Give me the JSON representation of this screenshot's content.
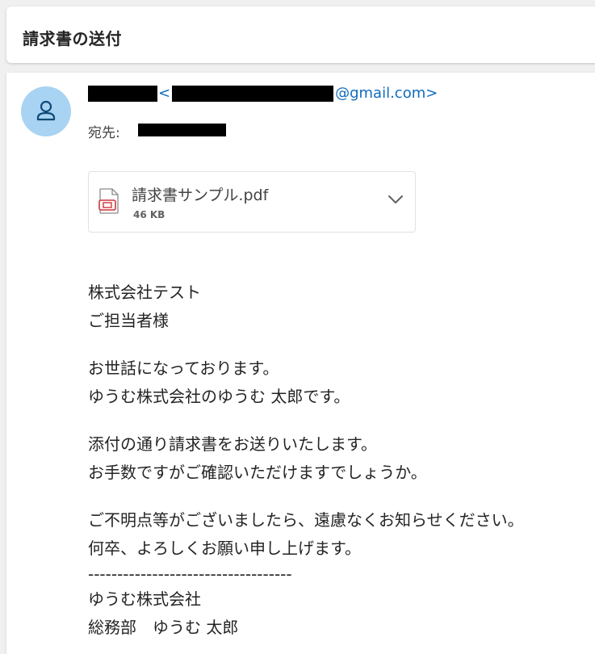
{
  "subject": "請求書の送付",
  "sender": {
    "email_prefix": "<",
    "email_domain": "@gmail.com>"
  },
  "recipient": {
    "label": "宛先:"
  },
  "attachment": {
    "icon": "pdf-file-icon",
    "name": "請求書サンプル.pdf",
    "size": "46 KB"
  },
  "body": {
    "greeting": [
      "株式会社テスト",
      "ご担当者様"
    ],
    "intro": [
      "お世話になっております。",
      "ゆうむ株式会社のゆうむ 太郎です。"
    ],
    "main": [
      "添付の通り請求書をお送りいたします。",
      "お手数ですがご確認いただけますでしょうか。"
    ],
    "closing": [
      "ご不明点等がございましたら、遠慮なくお知らせください。",
      "何卒、よろしくお願い申し上げます。"
    ],
    "signature": [
      "-----------------------------------",
      "ゆうむ株式会社",
      "総務部　ゆうむ 太郎"
    ]
  },
  "colors": {
    "accent": "#0f6cbd",
    "avatar_bg": "#a9d3f2",
    "pdf_icon": "#d13438"
  }
}
